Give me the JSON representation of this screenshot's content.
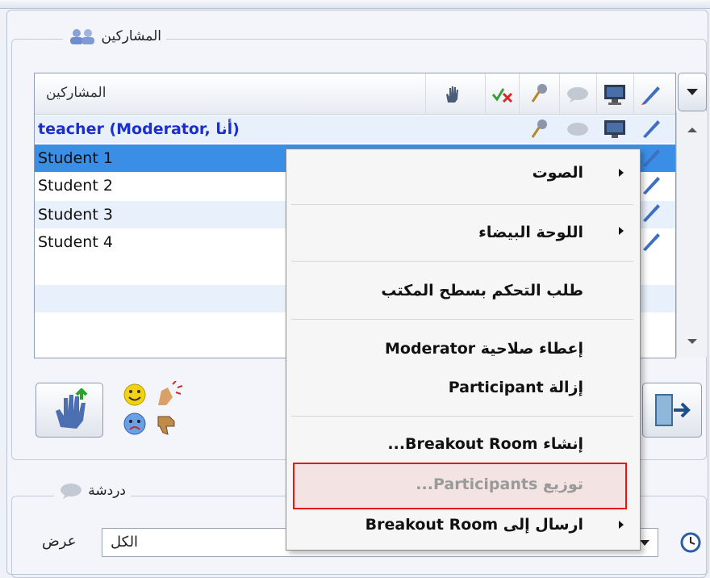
{
  "participants_panel": {
    "title": "المشاركين",
    "column_header": "المشاركين",
    "rows": [
      {
        "name": "teacher (Moderator, أنا)",
        "type": "teacher"
      },
      {
        "name": "Student 1",
        "type": "selected"
      },
      {
        "name": "Student 2",
        "type": "normal"
      },
      {
        "name": "Student 3",
        "type": "normal"
      },
      {
        "name": "Student 4",
        "type": "normal"
      }
    ]
  },
  "context_menu": {
    "items": {
      "audio": "الصوت",
      "whiteboard": "اللوحة البيضاء",
      "desktop_control": "طلب التحكم بسطح المكتب",
      "give_moderator": "إعطاء صلاحية Moderator",
      "remove_participant": "إزالة Participant",
      "create_breakout": "إنشاء Breakout Room...",
      "distribute": "توزيع Participants...",
      "send_to_breakout": "ارسال إلى Breakout Room"
    }
  },
  "chat_panel": {
    "title": "دردشة",
    "show_label": "عرض",
    "filter_value": "الكل"
  },
  "colors": {
    "selection": "#3a8ee6",
    "teacher_text": "#1b2fcf",
    "highlight_border": "#e01818"
  },
  "icons": {
    "participants": "people-icon",
    "raise_hand": "raise-hand-icon",
    "check_cross": "check-cross-icon",
    "microphone": "microphone-icon",
    "chat_bubble": "chat-bubble-icon",
    "monitor": "monitor-icon",
    "pen": "pen-icon",
    "exit": "exit-door-icon",
    "clock": "clock-icon"
  }
}
